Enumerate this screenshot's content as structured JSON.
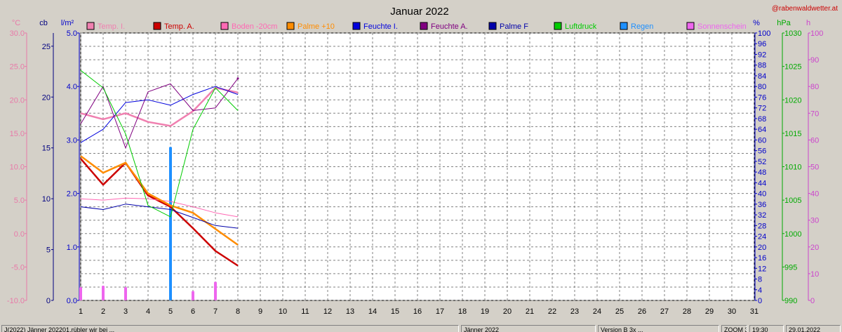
{
  "window": {
    "title": "Januar 2022",
    "watermark": "@rabenwaldwetter.at",
    "background": "#d4d0c8",
    "plot_background": "#ffffff"
  },
  "status_bar": {
    "cells": [
      "J(2022) Jänner 202201.rübler wir bei ...",
      "Jänner 2022",
      "Version B 3x ...",
      "ZOOM 3",
      "19:30",
      "29.01.2022"
    ]
  },
  "chart_data": {
    "type": "line",
    "title": "Januar 2022",
    "x": [
      1,
      2,
      3,
      4,
      5,
      6,
      7,
      8,
      9,
      10,
      11,
      12,
      13,
      14,
      15,
      16,
      17,
      18,
      19,
      20,
      21,
      22,
      23,
      24,
      25,
      26,
      27,
      28,
      29,
      30,
      31
    ],
    "xlim": [
      1,
      31
    ],
    "grid": true,
    "legend_position": "top",
    "axes": {
      "temp": {
        "unit": "°C",
        "min": -10,
        "max": 30,
        "ticks": [
          "30.0",
          "25.0",
          "20.0",
          "15.0",
          "10.0",
          "5.0",
          "0.0",
          "-5.0",
          "-10.0"
        ],
        "color": "#e87aa8"
      },
      "cb": {
        "unit": "cb",
        "min": 0,
        "max": 26.3,
        "ticks": [
          "25",
          "20",
          "15",
          "10",
          "5",
          "0"
        ],
        "color": "#000080"
      },
      "rain": {
        "unit": "l/m²",
        "min": 0,
        "max": 5,
        "ticks": [
          "5.0",
          "4.0",
          "3.0",
          "2.0",
          "1.0",
          "0.0"
        ],
        "color": "#0000cc"
      },
      "hum": {
        "unit": "%",
        "min": 0,
        "max": 100,
        "ticks": [
          "100",
          "96",
          "92",
          "88",
          "84",
          "80",
          "76",
          "72",
          "68",
          "64",
          "60",
          "56",
          "52",
          "48",
          "44",
          "40",
          "36",
          "32",
          "28",
          "24",
          "20",
          "16",
          "12",
          "8",
          "4",
          "0"
        ],
        "color": "#0000cc"
      },
      "press": {
        "unit": "hPa",
        "min": 990,
        "max": 1030,
        "ticks": [
          "1030",
          "1025",
          "1020",
          "1015",
          "1010",
          "1005",
          "1000",
          "995",
          "990"
        ],
        "color": "#00aa00"
      },
      "sun": {
        "unit": "h",
        "min": 0,
        "max": 100,
        "ticks": [
          "100",
          "90",
          "80",
          "70",
          "60",
          "50",
          "40",
          "30",
          "20",
          "10",
          "0"
        ],
        "color": "#cc44cc"
      }
    },
    "legend": [
      {
        "name": "Temp. I.",
        "color": "#f080b0"
      },
      {
        "name": "Temp. A.",
        "color": "#cc0000"
      },
      {
        "name": "Boden -20cm",
        "color": "#ff69b4"
      },
      {
        "name": "Palme +10",
        "color": "#ff8c00"
      },
      {
        "name": "Feuchte I.",
        "color": "#0000dd"
      },
      {
        "name": "Feuchte A.",
        "color": "#800080"
      },
      {
        "name": "Palme F",
        "color": "#0000aa"
      },
      {
        "name": "Luftdruck",
        "color": "#00cc00"
      },
      {
        "name": "Regen",
        "color": "#1e90ff"
      },
      {
        "name": "Sonnenschein",
        "color": "#ee66ee"
      }
    ],
    "series": [
      {
        "name": "Temp. I.",
        "axis": "temp",
        "color": "#f080b0",
        "width": 2.5,
        "values": [
          18.0,
          17.1,
          18.0,
          16.7,
          16.1,
          18.3,
          21.8,
          21.1
        ]
      },
      {
        "name": "Temp. A.",
        "axis": "temp",
        "color": "#cc0000",
        "width": 2.5,
        "values": [
          11.2,
          7.3,
          10.6,
          5.7,
          4.0,
          0.8,
          -2.6,
          -4.8
        ]
      },
      {
        "name": "Boden -20cm",
        "axis": "temp",
        "color": "#ff69b4",
        "width": 1,
        "values": [
          5.2,
          5.0,
          5.3,
          5.2,
          4.8,
          4.0,
          3.1,
          2.5
        ]
      },
      {
        "name": "Palme +10",
        "axis": "temp",
        "color": "#ff8c00",
        "width": 2.5,
        "values": [
          11.6,
          9.1,
          10.6,
          6.0,
          4.2,
          3.1,
          0.7,
          -1.7
        ]
      },
      {
        "name": "Feuchte I.",
        "axis": "hum",
        "color": "#0000dd",
        "width": 1,
        "values": [
          59,
          64,
          74,
          75,
          73,
          77,
          80,
          77
        ]
      },
      {
        "name": "Feuchte A.",
        "axis": "hum",
        "color": "#800080",
        "width": 1,
        "values": [
          66,
          80,
          57,
          78,
          81,
          71,
          72,
          83
        ]
      },
      {
        "name": "Palme F",
        "axis": "hum",
        "color": "#0000aa",
        "width": 1,
        "values": [
          35,
          34,
          36,
          35,
          34,
          31,
          28,
          27
        ]
      },
      {
        "name": "Luftdruck",
        "axis": "press",
        "color": "#00cc00",
        "width": 1,
        "values": [
          1024.4,
          1021.8,
          1014.9,
          1004.2,
          1002.5,
          1015.6,
          1021.8,
          1018.4
        ]
      }
    ],
    "bars": [
      {
        "name": "Regen",
        "axis": "rain",
        "color": "#1e90ff",
        "width": 4,
        "values": [
          0,
          0,
          0,
          0,
          2.87,
          0,
          0,
          0
        ]
      },
      {
        "name": "Sonnenschein",
        "axis": "sun",
        "color": "#ee66ee",
        "width": 4,
        "values": [
          5,
          5.5,
          5,
          0,
          0,
          3.5,
          7,
          0
        ]
      }
    ],
    "markers": [
      {
        "name": "Feuchte A. point",
        "axis": "hum",
        "color": "#800080",
        "x": 8,
        "value": 83
      }
    ]
  }
}
